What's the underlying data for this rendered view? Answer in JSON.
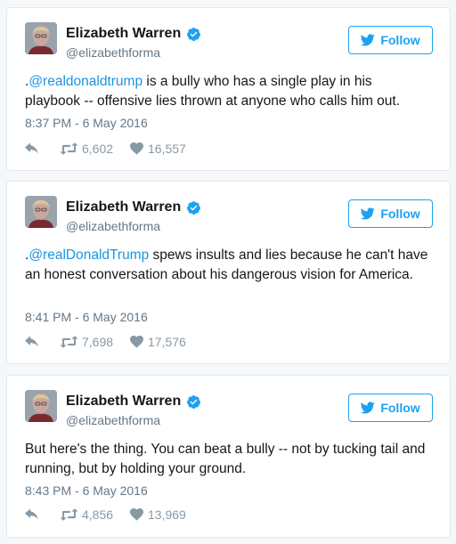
{
  "colors": {
    "accent": "#1da1f2",
    "mention": "#1b95e0",
    "muted": "#657786",
    "icon": "#8899a6",
    "border": "#e1e8ed",
    "background": "#f5f8fa"
  },
  "tweets": [
    {
      "author": {
        "name": "Elizabeth Warren",
        "handle": "@elizabethforma",
        "verified": true
      },
      "follow_label": "Follow",
      "text": {
        "prefix": ".",
        "mention": "@realdonaldtrump",
        "body": " is a bully who has a single play in his playbook -- offensive lies thrown at anyone who calls him out."
      },
      "timestamp": "8:37 PM - 6 May 2016",
      "retweets": "6,602",
      "likes": "16,557"
    },
    {
      "author": {
        "name": "Elizabeth Warren",
        "handle": "@elizabethforma",
        "verified": true
      },
      "follow_label": "Follow",
      "text": {
        "prefix": ".",
        "mention": "@realDonaldTrump",
        "body": " spews insults and lies because he can't have an honest conversation about his dangerous vision for America."
      },
      "timestamp": "8:41 PM - 6 May 2016",
      "retweets": "7,698",
      "likes": "17,576"
    },
    {
      "author": {
        "name": "Elizabeth Warren",
        "handle": "@elizabethforma",
        "verified": true
      },
      "follow_label": "Follow",
      "text": {
        "prefix": "",
        "mention": "",
        "body": "But here's the thing. You can beat a bully -- not by tucking tail and running, but by holding your ground."
      },
      "timestamp": "8:43 PM - 6 May 2016",
      "retweets": "4,856",
      "likes": "13,969"
    }
  ],
  "icons": {
    "verified": "verified-badge-icon",
    "follow": "twitter-bird-icon",
    "reply": "reply-icon",
    "retweet": "retweet-icon",
    "like": "heart-icon"
  }
}
